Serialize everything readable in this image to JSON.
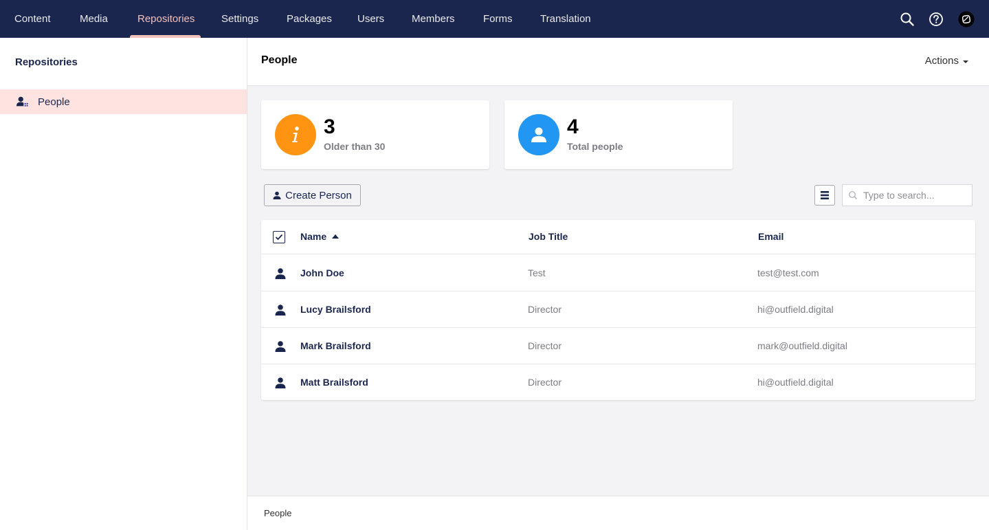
{
  "nav": {
    "items": [
      {
        "label": "Content"
      },
      {
        "label": "Media"
      },
      {
        "label": "Repositories"
      },
      {
        "label": "Settings"
      },
      {
        "label": "Packages"
      },
      {
        "label": "Users"
      },
      {
        "label": "Members"
      },
      {
        "label": "Forms"
      },
      {
        "label": "Translation"
      }
    ],
    "active": "Repositories",
    "icons": [
      "search-icon",
      "help-icon",
      "user-avatar-icon"
    ]
  },
  "sidebar": {
    "title": "Repositories",
    "items": [
      {
        "label": "People",
        "icon": "people-icon",
        "selected": true
      }
    ]
  },
  "main": {
    "title": "People",
    "actions_label": "Actions"
  },
  "stats": [
    {
      "value": "3",
      "caption": "Older than 30",
      "icon": "info-icon",
      "color": "#ff9412"
    },
    {
      "value": "4",
      "caption": "Total people",
      "icon": "person-icon",
      "color": "#2bc37c"
    }
  ],
  "toolbar": {
    "create_label": "Create Person",
    "search_placeholder": "Type to search..."
  },
  "table": {
    "columns": [
      "Name",
      "Job Title",
      "Email"
    ],
    "sorted_by": "Name",
    "rows": [
      {
        "name": "John Doe",
        "job": "Test",
        "email": "test@test.com"
      },
      {
        "name": "Lucy Brailsford",
        "job": "Director",
        "email": "hi@outfield.digital"
      },
      {
        "name": "Mark Brailsford",
        "job": "Director",
        "email": "mark@outfield.digital"
      },
      {
        "name": "Matt Brailsford",
        "job": "Director",
        "email": "hi@outfield.digital"
      }
    ]
  },
  "footer": {
    "breadcrumb": "People"
  },
  "colors": {
    "nav_bg": "#1b264f",
    "active_nav": "#f5c1bc",
    "selected_bg": "#ffe3e1",
    "info": "#ff9412",
    "person": "#2196f3"
  }
}
